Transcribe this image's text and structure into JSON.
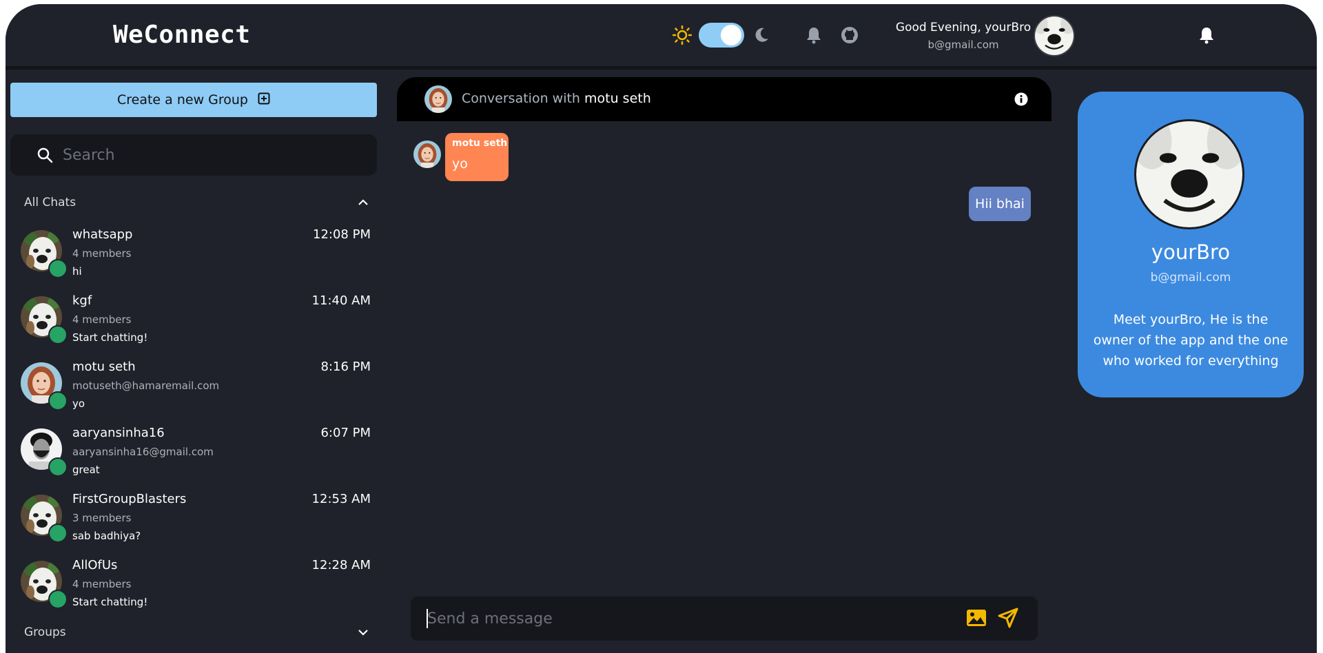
{
  "header": {
    "brand": "WeConnect",
    "greeting": "Good Evening, yourBro",
    "email": "b@gmail.com",
    "theme_toggle_on": true,
    "icons": [
      "sun-icon",
      "theme-toggle",
      "moon-icon",
      "bell-icon",
      "github-icon",
      "avatar",
      "bell-icon"
    ]
  },
  "sidebar": {
    "create_group_label": "Create a new Group",
    "search_placeholder": "Search",
    "all_chats_label": "All Chats",
    "groups_label": "Groups",
    "chats": [
      {
        "name": "whatsapp",
        "sub": "4 members",
        "last": "hi",
        "time": "12:08 PM",
        "avatar": "dog"
      },
      {
        "name": "kgf",
        "sub": "4 members",
        "last": "Start chatting!",
        "time": "11:40 AM",
        "avatar": "dog"
      },
      {
        "name": "motu seth",
        "sub": "motuseth@hamaremail.com",
        "last": "yo",
        "time": "8:16 PM",
        "avatar": "woman"
      },
      {
        "name": "aaryansinha16",
        "sub": "aaryansinha16@gmail.com",
        "last": "great",
        "time": "6:07 PM",
        "avatar": "man"
      },
      {
        "name": "FirstGroupBlasters",
        "sub": "3 members",
        "last": "sab badhiya?",
        "time": "12:53 AM",
        "avatar": "dog"
      },
      {
        "name": "AllOfUs",
        "sub": "4 members",
        "last": "Start chatting!",
        "time": "12:28 AM",
        "avatar": "dog"
      }
    ]
  },
  "conversation": {
    "title_prefix": "Conversation with",
    "title_name": "motu seth",
    "messages": [
      {
        "sender": "motu seth",
        "text": "yo",
        "direction": "incoming"
      },
      {
        "text": "Hii bhai",
        "direction": "outgoing"
      }
    ],
    "composer_placeholder": "Send a message"
  },
  "profile": {
    "name": "yourBro",
    "email": "b@gmail.com",
    "bio": "Meet yourBro, He is the owner of the app and the one who worked for everything"
  },
  "colors": {
    "background": "#1f222a",
    "accent_blue": "#8ecbf5",
    "profile_card": "#3c8ae0",
    "incoming_bubble": "#ff8552",
    "outgoing_bubble": "#6381c3",
    "online_dot": "#27a365",
    "send_icon": "#f5b800"
  }
}
